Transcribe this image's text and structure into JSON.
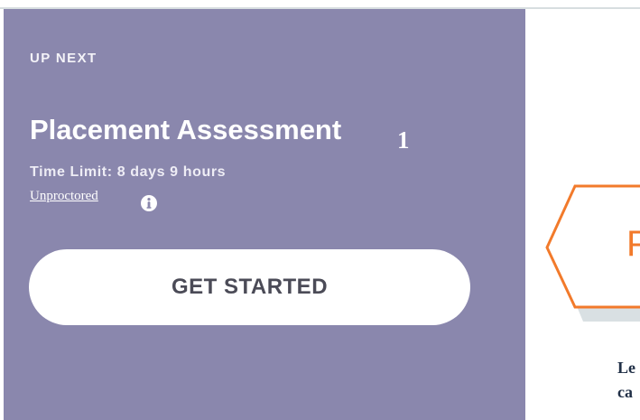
{
  "card": {
    "eyebrow": "UP NEXT",
    "title": "Placement Assessment",
    "title_marker": "1",
    "time_limit": "Time Limit: 8 days 9 hours",
    "proctoring_link": "Unproctored",
    "info_icon": "info-icon",
    "start_button": "GET STARTED"
  },
  "preview": {
    "badge_letter": "P",
    "snippet_lines": [
      "Le",
      "ca"
    ]
  },
  "colors": {
    "panel_background": "#8a87ad",
    "button_background": "#ffffff",
    "button_text": "#4b4b57",
    "badge_outline": "#f27a2b",
    "snippet_text": "#213047"
  }
}
